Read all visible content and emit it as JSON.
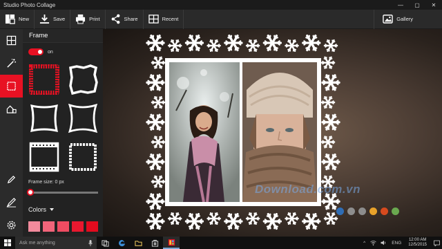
{
  "window": {
    "title": "Studio Photo Collage",
    "controls": [
      "—",
      "▢",
      "✕"
    ]
  },
  "toolbar": {
    "new_label": "New",
    "save_label": "Save",
    "print_label": "Print",
    "share_label": "Share",
    "recent_label": "Recent",
    "gallery_label": "Gallery"
  },
  "rail": {
    "items": [
      {
        "icon": "grid-icon"
      },
      {
        "icon": "magic-wand-icon"
      },
      {
        "icon": "frame-icon",
        "active": true
      },
      {
        "icon": "home-background-icon"
      }
    ],
    "bottom": [
      {
        "icon": "pencil-icon"
      },
      {
        "icon": "pen-icon"
      },
      {
        "icon": "gear-icon"
      }
    ]
  },
  "panel": {
    "title": "Frame",
    "toggle_label": "on",
    "toggle_on": true,
    "frame_size_label": "Frame size: 0 px",
    "frame_size_value": 0,
    "colors_label": "Colors",
    "swatches": [
      "#f28a9c",
      "#f2647a",
      "#ef4c62",
      "#e8182f",
      "#e30b1e"
    ]
  },
  "canvas": {
    "watermark": "Download.com.vn",
    "dots": [
      "#2f6db5",
      "#8e8e8e",
      "#8c8c8c",
      "#e8a22a",
      "#d64a1e",
      "#6aa84f"
    ]
  },
  "taskbar": {
    "search_placeholder": "Ask me anything",
    "language": "ENG",
    "time": "12:00 AM",
    "date": "12/5/2015"
  },
  "colors": {
    "accent": "#e81123",
    "panel_bg": "#222222",
    "toolbar_bg": "#2a2a2a"
  }
}
